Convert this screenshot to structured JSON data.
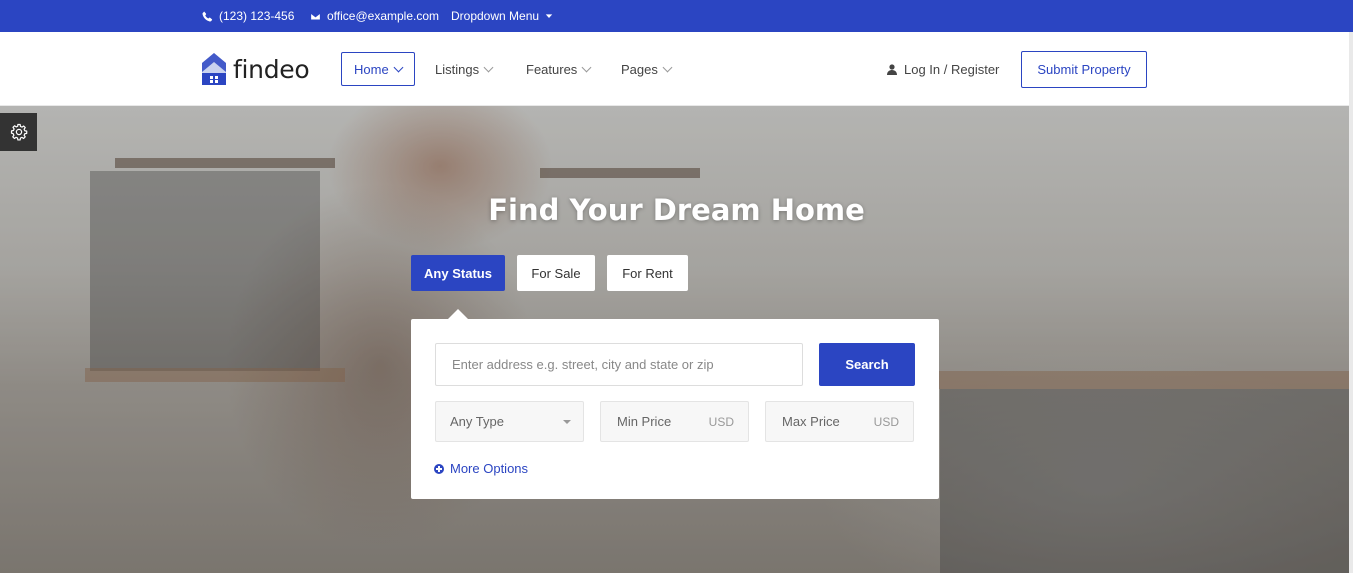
{
  "topbar": {
    "phone": "(123) 123-456",
    "email": "office@example.com",
    "dropdown": "Dropdown Menu",
    "phone_icon": "phone-icon",
    "email_icon": "envelope-icon",
    "caret_icon": "caret-down-icon"
  },
  "header": {
    "logo_text": "findeo",
    "nav": [
      {
        "label": "Home",
        "active": true
      },
      {
        "label": "Listings",
        "active": false
      },
      {
        "label": "Features",
        "active": false
      },
      {
        "label": "Pages",
        "active": false
      }
    ],
    "login_label": "Log In / Register",
    "submit_label": "Submit Property"
  },
  "hero": {
    "title": "Find Your Dream Home",
    "status_tabs": [
      {
        "label": "Any Status",
        "active": true
      },
      {
        "label": "For Sale",
        "active": false
      },
      {
        "label": "For Rent",
        "active": false
      }
    ]
  },
  "search": {
    "placeholder": "Enter address e.g. street, city and state or zip",
    "button_label": "Search",
    "type_select": "Any Type",
    "min_price": "Min Price",
    "max_price": "Max Price",
    "currency": "USD",
    "more_options": "More Options"
  },
  "colors": {
    "accent": "#2b45c2",
    "topbar_bg": "#2b45c2",
    "settings_bg": "#333333"
  }
}
